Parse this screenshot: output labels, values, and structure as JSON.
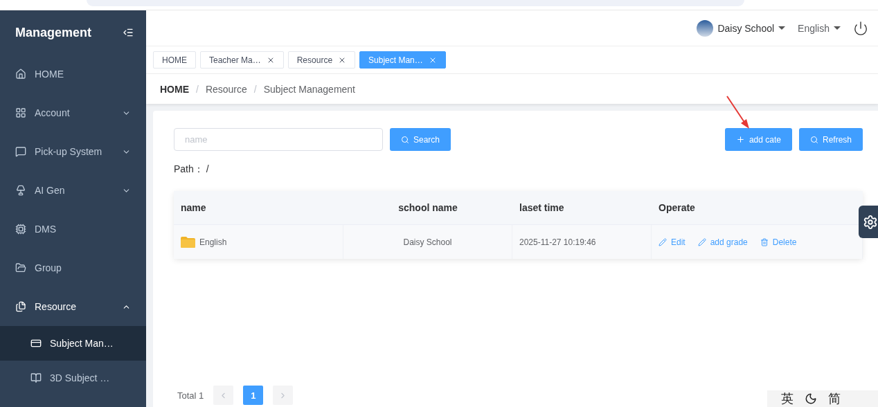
{
  "sidebar": {
    "title": "Management",
    "items": [
      {
        "label": "HOME",
        "kind": "link",
        "expanded": false,
        "selected": false
      },
      {
        "label": "Account",
        "kind": "submenu",
        "expanded": false,
        "selected": false
      },
      {
        "label": "Pick-up System",
        "kind": "submenu",
        "expanded": false,
        "selected": false
      },
      {
        "label": "AI Gen",
        "kind": "submenu",
        "expanded": false,
        "selected": false
      },
      {
        "label": "DMS",
        "kind": "link",
        "expanded": false,
        "selected": false
      },
      {
        "label": "Group",
        "kind": "link",
        "expanded": false,
        "selected": false
      },
      {
        "label": "Resource",
        "kind": "submenu",
        "expanded": true,
        "selected": false,
        "children": [
          {
            "label": "Subject Man…",
            "selected": true
          },
          {
            "label": "3D Subject …",
            "selected": false
          }
        ]
      }
    ]
  },
  "header": {
    "user": "Daisy School",
    "language": "English"
  },
  "tabs": [
    {
      "label": "HOME",
      "closable": false,
      "selected": false
    },
    {
      "label": "Teacher Ma…",
      "closable": true,
      "selected": false
    },
    {
      "label": "Resource",
      "closable": true,
      "selected": false
    },
    {
      "label": "Subject Man…",
      "closable": true,
      "selected": true
    }
  ],
  "breadcrumb": {
    "separator": "/",
    "items": [
      "HOME",
      "Resource",
      "Subject Management"
    ]
  },
  "search": {
    "placeholder": "name",
    "button": "Search"
  },
  "actions": [
    "add cate",
    "Refresh"
  ],
  "path": {
    "label": "Path：",
    "value": "/"
  },
  "table": {
    "columns": [
      "name",
      "school name",
      "laset time",
      "Operate"
    ],
    "rows": [
      {
        "name": "English",
        "school": "Daisy School",
        "time": "2025-11-27 10:19:46",
        "operations": [
          "Edit",
          "add grade",
          "Delete"
        ]
      }
    ]
  },
  "pagination": {
    "total": "Total 1",
    "pages": [
      {
        "label": "1",
        "selected": true
      }
    ]
  },
  "ime": [
    "英",
    "简"
  ]
}
